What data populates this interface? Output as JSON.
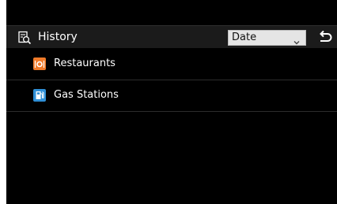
{
  "header": {
    "title": "History",
    "title_icon": "history-search-icon",
    "sort": {
      "selected": "Date",
      "icon": "chevron-down-icon"
    },
    "back_icon": "back-arrow-icon"
  },
  "list": {
    "items": [
      {
        "label": "Restaurants",
        "icon": "restaurant-icon",
        "icon_color": "#f07b2a"
      },
      {
        "label": "Gas Stations",
        "icon": "gas-station-icon",
        "icon_color": "#2f8fd6"
      }
    ]
  },
  "colors": {
    "screen_bg": "#000000",
    "header_bg": "#1b1b1b",
    "select_bg": "#e5e5e5",
    "text": "#ffffff"
  }
}
